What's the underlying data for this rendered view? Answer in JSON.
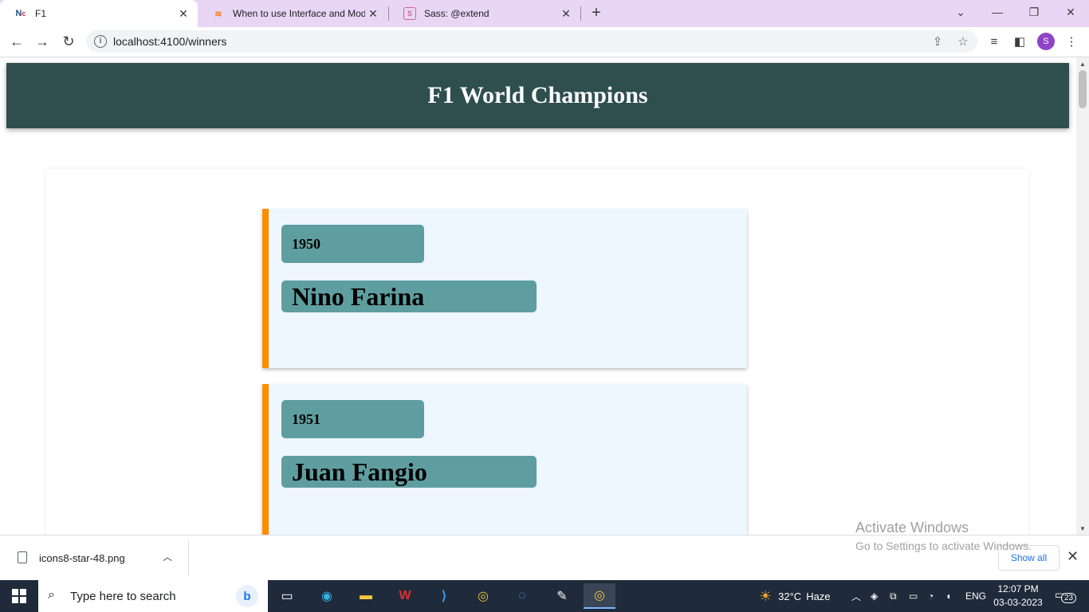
{
  "browser": {
    "tabs": [
      {
        "icon": "ng-icon",
        "title": "F1"
      },
      {
        "icon": "stackoverflow-icon",
        "title": "When to use Interface and Mode"
      },
      {
        "icon": "sass-icon",
        "title": "Sass: @extend"
      }
    ],
    "url": "localhost:4100/winners",
    "profile_initial": "S"
  },
  "page": {
    "title": "F1 World Champions",
    "champions": [
      {
        "year": "1950",
        "name": "Nino Farina"
      },
      {
        "year": "1951",
        "name": "Juan Fangio"
      }
    ]
  },
  "colors": {
    "header_bg": "#2f4f4f",
    "card_bg": "#eef6ff",
    "card_accent": "#ff8c00",
    "label_bg": "#5f9ea0"
  },
  "watermark": {
    "line1": "Activate Windows",
    "line2": "Go to Settings to activate Windows."
  },
  "downloads": {
    "file_name": "icons8-star-48.png",
    "show_all": "Show all"
  },
  "taskbar": {
    "search_placeholder": "Type here to search",
    "weather_temp": "32°C",
    "weather_desc": "Haze",
    "language": "ENG",
    "time": "12:07 PM",
    "date": "03-03-2023",
    "notification_count": "23"
  }
}
